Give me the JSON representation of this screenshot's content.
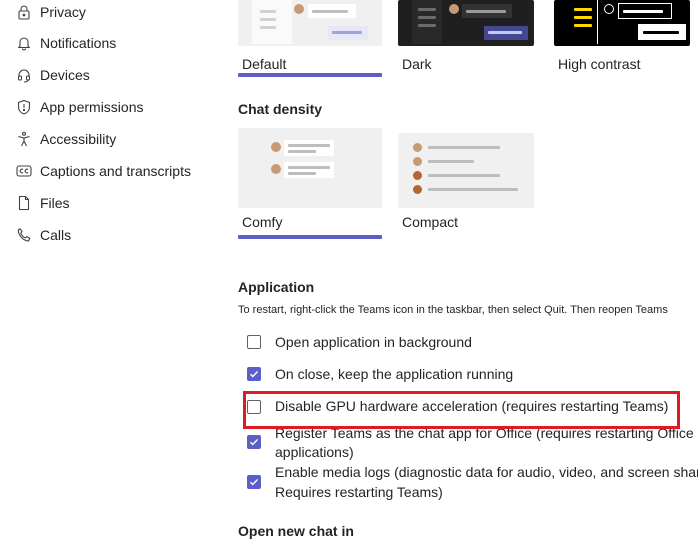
{
  "sidebar": {
    "items": [
      {
        "label": "Privacy",
        "icon": "lock-icon"
      },
      {
        "label": "Notifications",
        "icon": "bell-icon"
      },
      {
        "label": "Devices",
        "icon": "headset-icon"
      },
      {
        "label": "App permissions",
        "icon": "shield-icon"
      },
      {
        "label": "Accessibility",
        "icon": "accessibility-icon"
      },
      {
        "label": "Captions and transcripts",
        "icon": "cc-icon"
      },
      {
        "label": "Files",
        "icon": "file-icon"
      },
      {
        "label": "Calls",
        "icon": "phone-icon"
      }
    ]
  },
  "theme": {
    "options": [
      {
        "label": "Default",
        "selected": true
      },
      {
        "label": "Dark",
        "selected": false
      },
      {
        "label": "High contrast",
        "selected": false
      }
    ]
  },
  "chat_density": {
    "title": "Chat density",
    "options": [
      {
        "label": "Comfy",
        "selected": true
      },
      {
        "label": "Compact",
        "selected": false
      }
    ]
  },
  "application": {
    "title": "Application",
    "hint": "To restart, right-click the Teams icon in the taskbar, then select Quit. Then reopen Teams",
    "options": [
      {
        "line1": "Open application in background",
        "line2": "",
        "checked": false
      },
      {
        "line1": "On close, keep the application running",
        "line2": "",
        "checked": true
      },
      {
        "line1": "Disable GPU hardware acceleration (requires restarting Teams)",
        "line2": "",
        "checked": false
      },
      {
        "line1": "Register Teams as the chat app for Office (requires restarting Office",
        "line2": "applications)",
        "checked": true
      },
      {
        "line1": "Enable media logs (diagnostic data for audio, video, and screen sharing",
        "line2": "Requires restarting Teams)",
        "checked": true
      }
    ]
  },
  "open_new_chat": {
    "title": "Open new chat in"
  },
  "colors": {
    "accent": "#5b5fc7",
    "highlight": "#e01a22"
  }
}
